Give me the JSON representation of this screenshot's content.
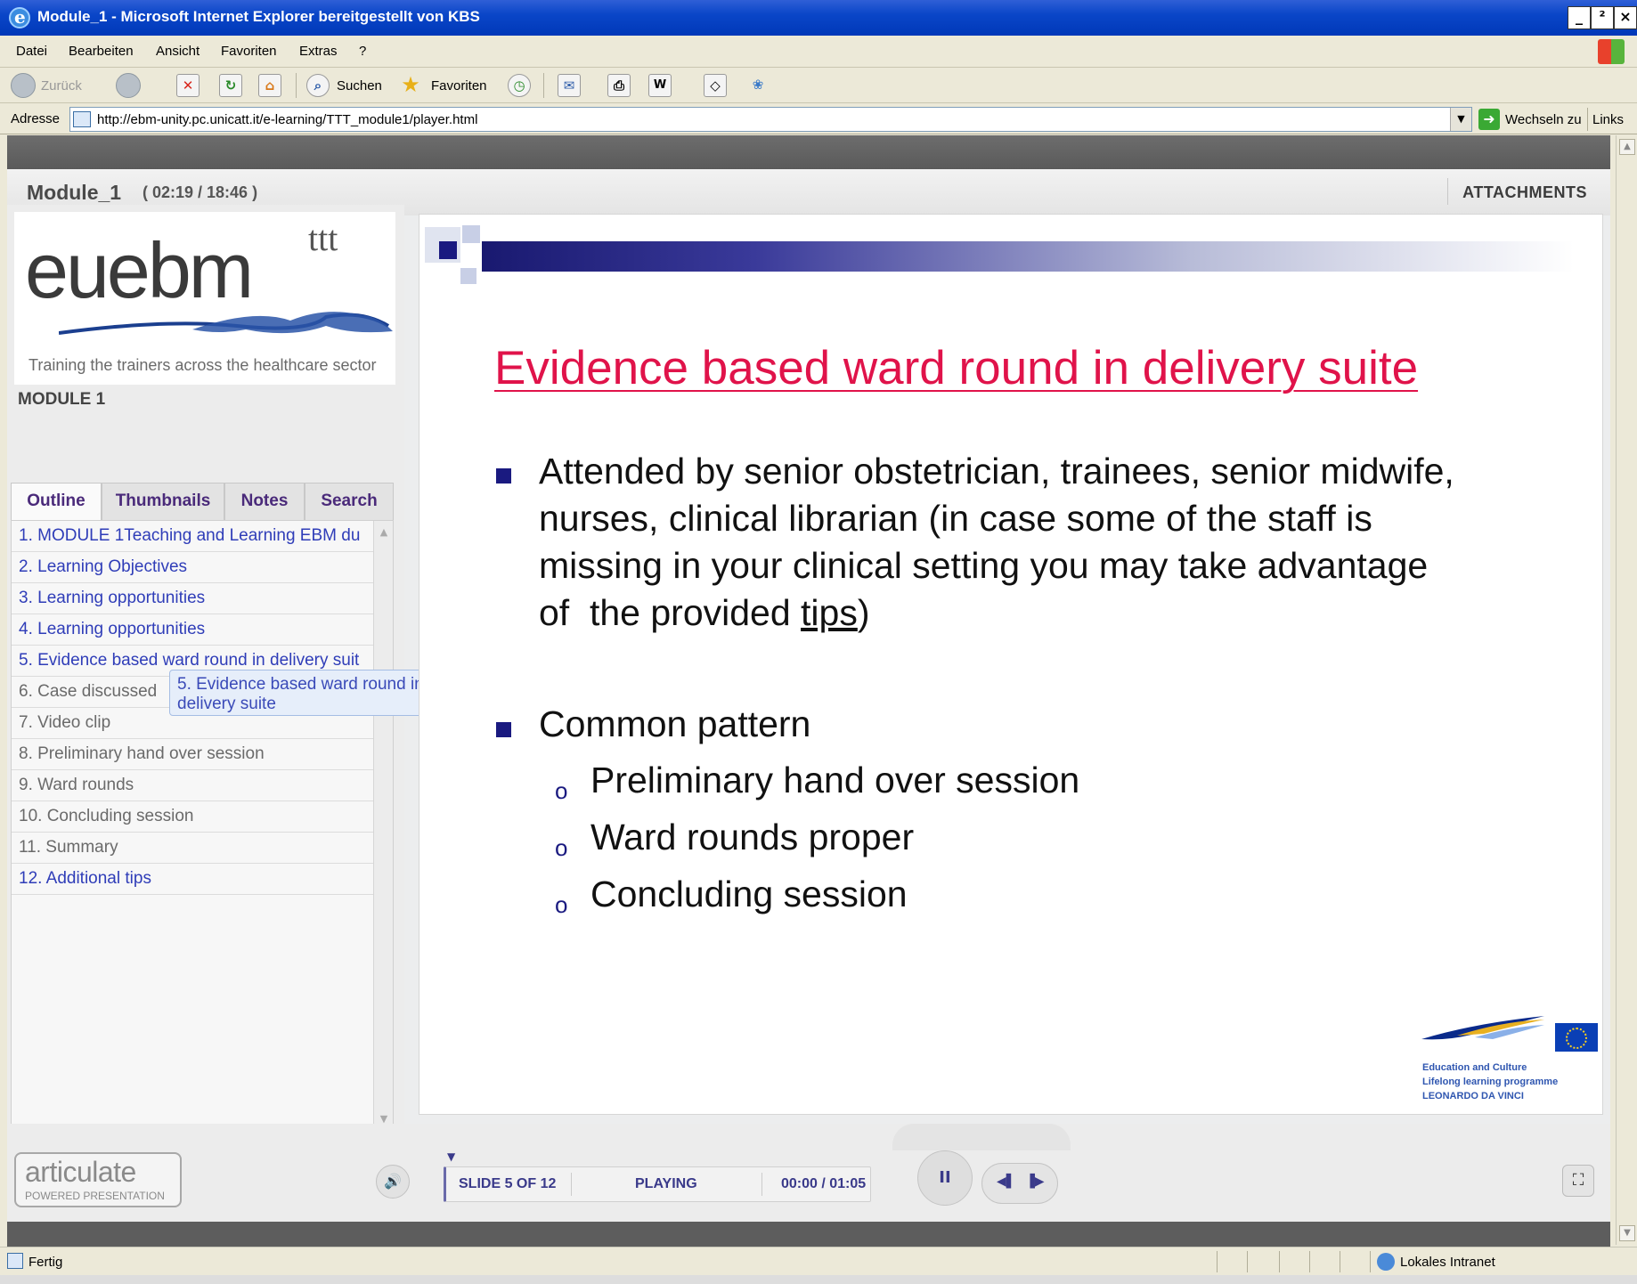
{
  "window": {
    "title": "Module_1 - Microsoft Internet Explorer bereitgestellt von KBS",
    "controls": [
      "_",
      "²",
      "×"
    ]
  },
  "menu": {
    "items": [
      "Datei",
      "Bearbeiten",
      "Ansicht",
      "Favoriten",
      "Extras",
      "?"
    ]
  },
  "toolbar": {
    "back_label": "Zurück",
    "search_label": "Suchen",
    "favorites_label": "Favoriten"
  },
  "address": {
    "label": "Adresse",
    "url": "http://ebm-unity.pc.unicatt.it/e-learning/TTT_module1/player.html",
    "go_label": "Wechseln zu",
    "links_label": "Links"
  },
  "player": {
    "module_title": "Module_1",
    "time": "( 02:19 / 18:46 )",
    "attachments_label": "ATTACHMENTS"
  },
  "sidebar": {
    "logo_text": "euebm",
    "logo_sup": "ttt",
    "tagline": "Training the trainers across the healthcare sector",
    "module_label": "MODULE 1",
    "tabs": [
      "Outline",
      "Thumbnails",
      "Notes",
      "Search"
    ],
    "outline": [
      {
        "label": "1. MODULE 1Teaching and Learning EBM du",
        "visited": true
      },
      {
        "label": "2. Learning Objectives",
        "visited": true
      },
      {
        "label": "3. Learning opportunities",
        "visited": true
      },
      {
        "label": "4. Learning opportunities",
        "visited": true
      },
      {
        "label": "5. Evidence based ward round in delivery suit",
        "visited": true
      },
      {
        "label": "6. Case discussed",
        "visited": false
      },
      {
        "label": "7. Video clip",
        "visited": false
      },
      {
        "label": "8. Preliminary hand over session",
        "visited": false
      },
      {
        "label": "9. Ward rounds",
        "visited": false
      },
      {
        "label": "10. Concluding session",
        "visited": false
      },
      {
        "label": "11. Summary",
        "visited": false
      },
      {
        "label": "12. Additional tips",
        "visited": true
      }
    ],
    "tooltip": "5. Evidence based ward round in delivery suite"
  },
  "slide": {
    "title": "Evidence based ward round in delivery suite",
    "bullet1_lines": [
      "Attended by senior obstetrician, trainees, senior midwife,",
      "nurses, clinical librarian (in case some of the staff is",
      "missing in your clinical setting you may take advantage"
    ],
    "bullet1_last_prefix": "of  the provided ",
    "bullet1_link": "tips",
    "bullet1_suffix": ")",
    "bullet2": "Common pattern",
    "sub_bullets": [
      "Preliminary hand over session",
      "Ward rounds proper",
      "Concluding session"
    ],
    "sub_marker": "o",
    "eu_lines": [
      "Education and Culture",
      "Lifelong learning programme",
      "LEONARDO DA VINCI"
    ]
  },
  "controls": {
    "articulate": "articulate",
    "articulate_sub": "POWERED PRESENTATION",
    "slide_counter": "SLIDE 5 OF 12",
    "state": "PLAYING",
    "time": "00:00 / 01:05",
    "pause_glyph": "II",
    "prev_glyph": "◀▌",
    "next_glyph": "▐▶"
  },
  "status": {
    "text": "Fertig",
    "zone": "Lokales Intranet"
  }
}
